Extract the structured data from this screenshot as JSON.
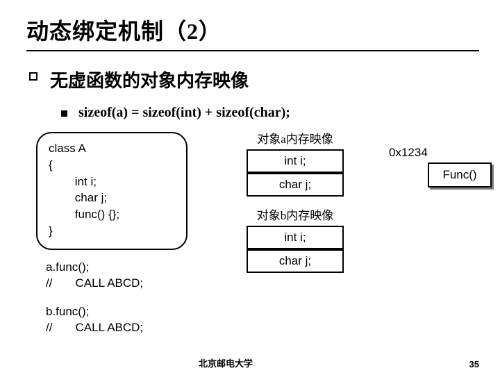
{
  "title": "动态绑定机制（2）",
  "bullet1": "无虚函数的对象内存映像",
  "bullet2": "sizeof(a) = sizeof(int) + sizeof(char);",
  "code": {
    "l1": "class A",
    "l2": "{",
    "l3": "        int i;",
    "l4": "        char j;",
    "l5": "        func() {};",
    "l6": "}"
  },
  "callA": "a.func();\n//       CALL ABCD;",
  "callB": "b.func();\n//       CALL ABCD;",
  "memA": {
    "label": "对象a内存映像",
    "cell1": "int i;",
    "cell2": "char j;"
  },
  "memB": {
    "label": "对象b内存映像",
    "cell1": "int i;",
    "cell2": "char j;"
  },
  "addr": "0x1234",
  "funcbox": "Func()",
  "footer": {
    "univ": "北京邮电大学",
    "page": "35"
  }
}
